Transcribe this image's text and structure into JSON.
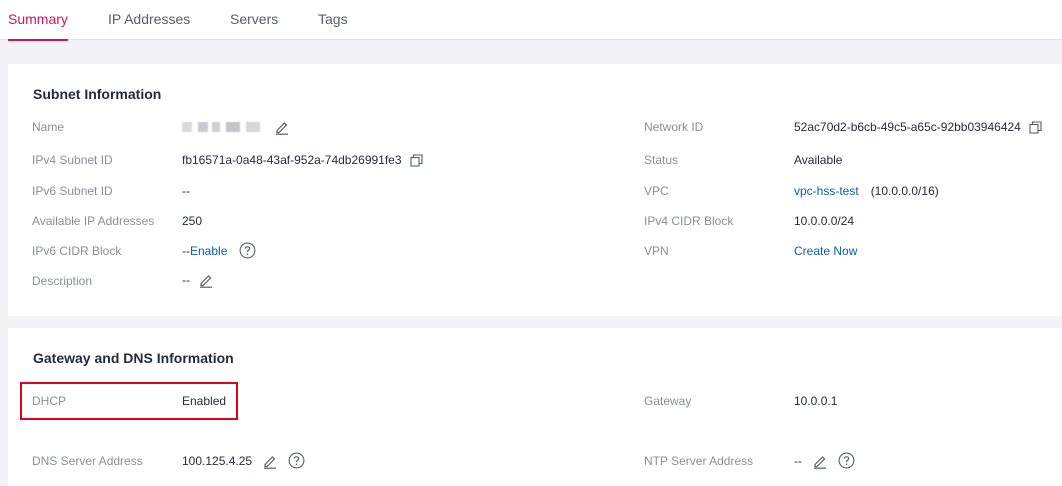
{
  "tabs": [
    "Summary",
    "IP Addresses",
    "Servers",
    "Tags"
  ],
  "subnet": {
    "title": "Subnet Information",
    "name_label": "Name",
    "ipv4_subnet_id_label": "IPv4 Subnet ID",
    "ipv4_subnet_id": "fb16571a-0a48-43af-952a-74db26991fe3",
    "ipv6_subnet_id_label": "IPv6 Subnet ID",
    "ipv6_subnet_id": "--",
    "available_ip_label": "Available IP Addresses",
    "available_ip": "250",
    "ipv6_cidr_label": "IPv6 CIDR Block",
    "ipv6_cidr_prefix": "--",
    "ipv6_enable_link": "Enable",
    "description_label": "Description",
    "description": "--",
    "network_id_label": "Network ID",
    "network_id": "52ac70d2-b6cb-49c5-a65c-92bb03946424",
    "status_label": "Status",
    "status": "Available",
    "vpc_label": "VPC",
    "vpc_link": "vpc-hss-test",
    "vpc_cidr": "(10.0.0.0/16)",
    "ipv4_cidr_label": "IPv4 CIDR Block",
    "ipv4_cidr": "10.0.0.0/24",
    "vpn_label": "VPN",
    "vpn_link": "Create Now"
  },
  "gateway": {
    "title": "Gateway and DNS Information",
    "dhcp_label": "DHCP",
    "dhcp": "Enabled",
    "gateway_label": "Gateway",
    "gateway": "10.0.0.1",
    "dns_label": "DNS Server Address",
    "dns": "100.125.4.25",
    "ntp_label": "NTP Server Address",
    "ntp": "--"
  },
  "colors": {
    "accent": "#d4145a",
    "link": "#0b5fa5",
    "highlight": "#e3001b"
  },
  "icons": {
    "edit": "pencil-icon",
    "copy": "copy-icon",
    "help": "question-circle-icon"
  }
}
